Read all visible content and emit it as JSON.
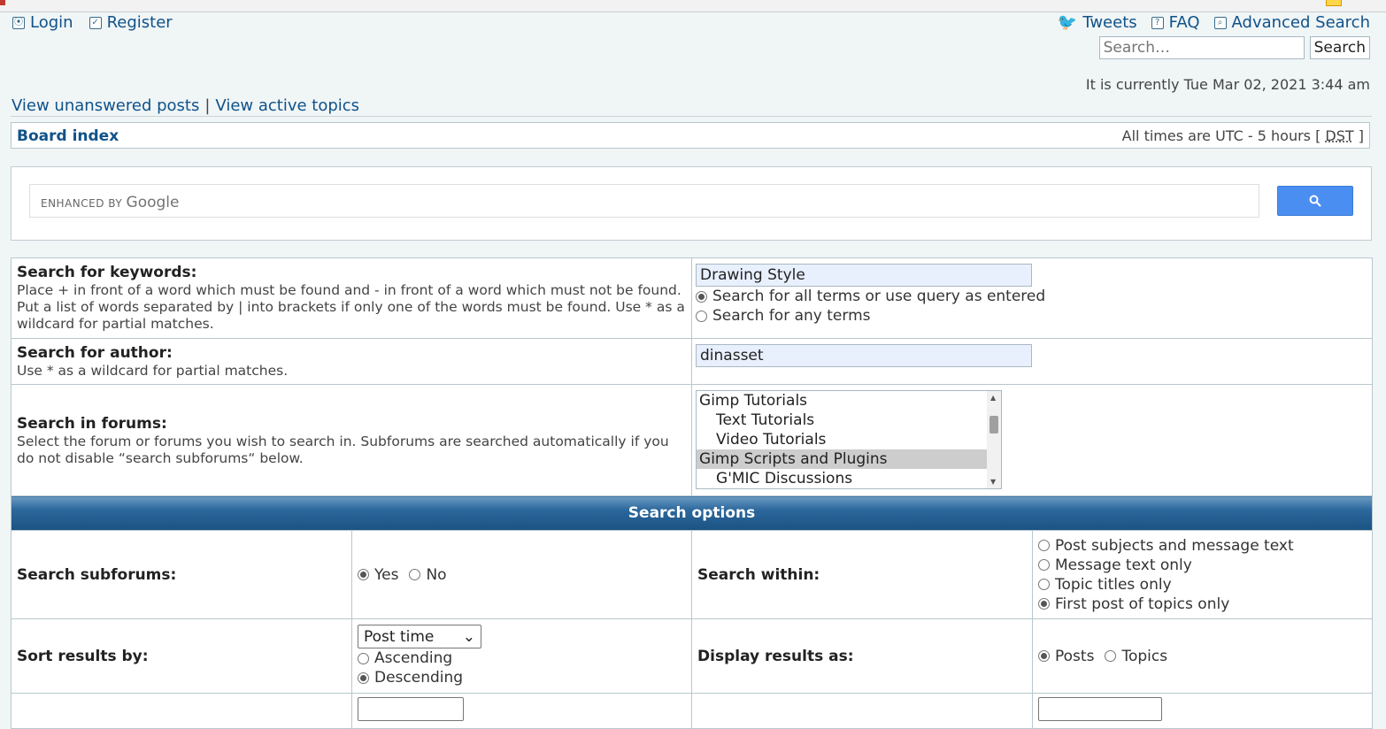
{
  "top_nav": {
    "login": "Login",
    "register": "Register",
    "tweets": "Tweets",
    "faq": "FAQ",
    "advanced_search": "Advanced Search"
  },
  "top_search": {
    "placeholder": "Search…",
    "button": "Search"
  },
  "current_time": "It is currently Tue Mar 02, 2021 3:44 am",
  "quicklinks": {
    "unanswered": "View unanswered posts",
    "separator": "|",
    "active": "View active topics"
  },
  "breadcrumb": {
    "board_index": "Board index",
    "timezone_prefix": "All times are UTC - 5 hours [ ",
    "dst": "DST",
    "timezone_suffix": " ]"
  },
  "google": {
    "enhanced_by": "ENHANCED BY",
    "brand": "Google"
  },
  "keywords": {
    "title": "Search for keywords:",
    "help": "Place + in front of a word which must be found and - in front of a word which must not be found. Put a list of words separated by | into brackets if only one of the words must be found. Use * as a wildcard for partial matches.",
    "value": "Drawing Style",
    "option_all": "Search for all terms or use query as entered",
    "option_any": "Search for any terms"
  },
  "author": {
    "title": "Search for author:",
    "help": "Use * as a wildcard for partial matches.",
    "value": "dinasset"
  },
  "forums": {
    "title": "Search in forums:",
    "help": "Select the forum or forums you wish to search in. Subforums are searched automatically if you do not disable “search subforums“ below.",
    "items": [
      {
        "label": "Gimp Tutorials"
      },
      {
        "label": "Text Tutorials"
      },
      {
        "label": "Video Tutorials"
      },
      {
        "label": "Gimp Scripts and Plugins"
      },
      {
        "label": "G'MIC Discussions"
      }
    ]
  },
  "options": {
    "header": "Search options",
    "subforums_label": "Search subforums:",
    "yes": "Yes",
    "no": "No",
    "within_label": "Search within:",
    "within": [
      "Post subjects and message text",
      "Message text only",
      "Topic titles only",
      "First post of topics only"
    ],
    "sort_label": "Sort results by:",
    "sort_value": "Post time",
    "ascending": "Ascending",
    "descending": "Descending",
    "display_label": "Display results as:",
    "posts": "Posts",
    "topics": "Topics"
  }
}
